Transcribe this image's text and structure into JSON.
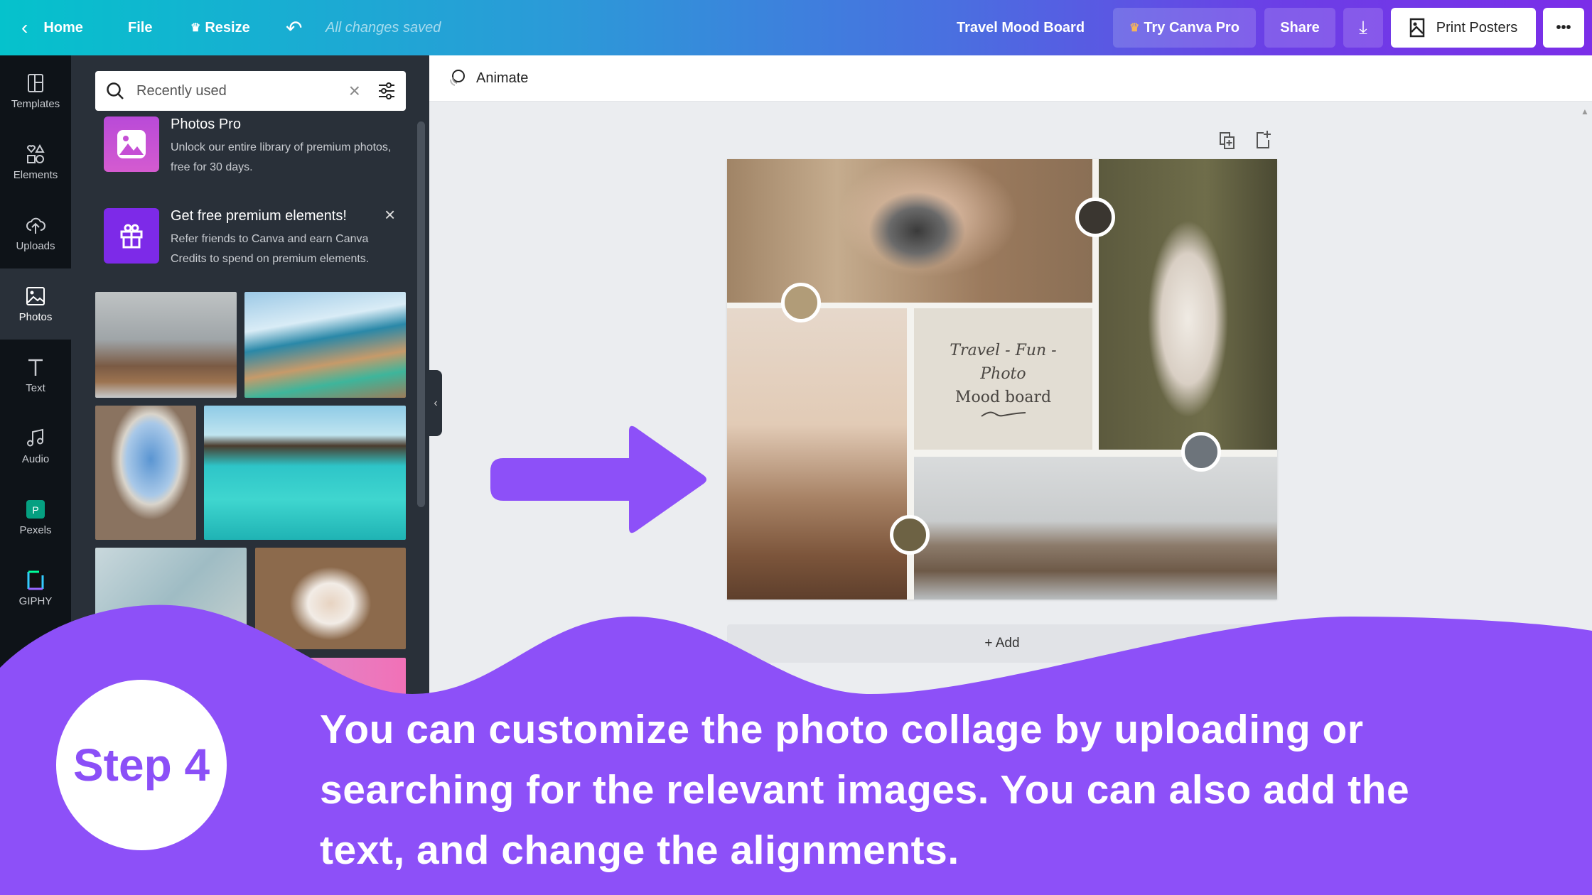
{
  "topbar": {
    "home": "Home",
    "file": "File",
    "resize": "Resize",
    "status": "All changes saved",
    "title": "Travel Mood Board",
    "try_pro": "Try Canva Pro",
    "share": "Share",
    "print": "Print Posters",
    "more": "•••"
  },
  "rail": [
    {
      "label": "Templates",
      "icon": "templates-icon"
    },
    {
      "label": "Elements",
      "icon": "elements-icon"
    },
    {
      "label": "Uploads",
      "icon": "upload-cloud-icon"
    },
    {
      "label": "Photos",
      "icon": "photo-icon"
    },
    {
      "label": "Text",
      "icon": "text-icon"
    },
    {
      "label": "Audio",
      "icon": "music-note-icon"
    },
    {
      "label": "Pexels",
      "icon": "pexels-icon"
    },
    {
      "label": "GIPHY",
      "icon": "giphy-icon"
    }
  ],
  "panel": {
    "search_value": "Recently used",
    "promo1": {
      "title": "Photos Pro",
      "desc": "Unlock our entire library of premium photos, free for 30 days."
    },
    "promo2": {
      "title": "Get free premium elements!",
      "desc": "Refer friends to Canva and earn Canva Credits to spend on premium elements.",
      "close": "×"
    }
  },
  "canvas": {
    "animate": "Animate",
    "text_lines": [
      "Travel  - Fun -",
      "Photo",
      "Mood board"
    ],
    "add_page": "+ Add"
  },
  "overlay": {
    "step": "Step 4",
    "caption": [
      "You can customize the photo collage by uploading or",
      "searching for the relevant images. You can also add the",
      "text, and change the alignments."
    ]
  },
  "colors": {
    "accent": "#8d50f8",
    "wave": "#8d50f8",
    "topbar_start": "#05c2cc",
    "topbar_end": "#7b2ee8"
  }
}
